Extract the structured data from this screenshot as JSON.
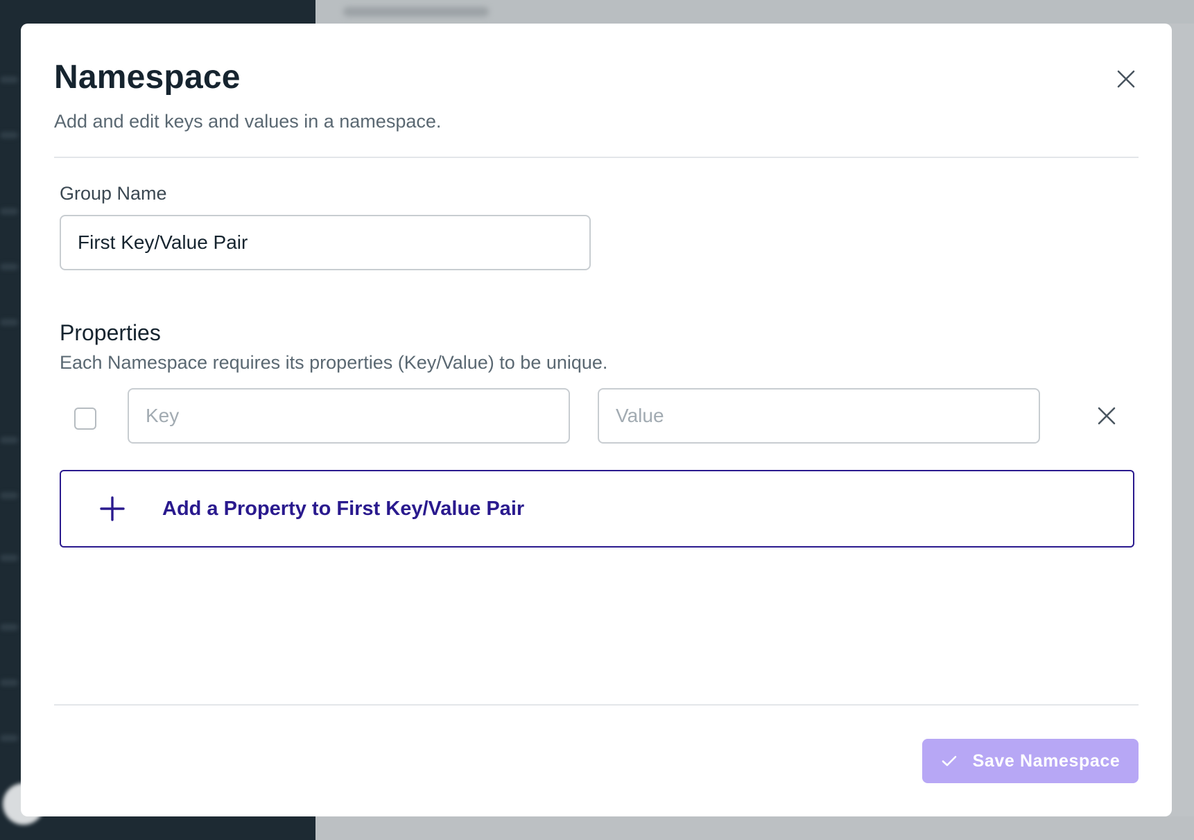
{
  "modal": {
    "title": "Namespace",
    "subtitle": "Add and edit keys and values in a namespace.",
    "close_icon": "close-icon"
  },
  "group": {
    "label": "Group Name",
    "value": "First Key/Value Pair"
  },
  "properties": {
    "title": "Properties",
    "description": "Each Namespace requires its properties (Key/Value) to be unique.",
    "rows": [
      {
        "key_placeholder": "Key",
        "value_placeholder": "Value",
        "key": "",
        "value": "",
        "checked": false
      }
    ],
    "add_label": "Add a Property to First Key/Value Pair",
    "add_icon": "plus-icon"
  },
  "footer": {
    "save_label": "Save Namespace",
    "save_icon": "check-icon"
  },
  "colors": {
    "primary": "#2a1a8e",
    "save_disabled": "#b7a7f5",
    "title": "#16242f",
    "muted": "#5a6872"
  }
}
